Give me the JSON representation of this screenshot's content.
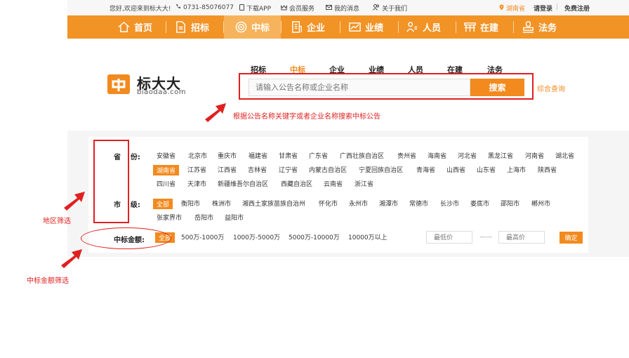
{
  "topbar": {
    "welcome": "您好,欢迎来到标大大!",
    "phone": "0731-85076077",
    "app": "下载APP",
    "member": "会员服务",
    "message": "我的消息",
    "about": "关于我们",
    "location": "湖南省",
    "login": "请登录",
    "divider": "|",
    "register": "免费注册"
  },
  "nav": {
    "items": [
      {
        "label": "首页",
        "icon": "home-icon"
      },
      {
        "label": "招标",
        "icon": "document-icon"
      },
      {
        "label": "中标",
        "icon": "target-icon"
      },
      {
        "label": "企业",
        "icon": "building-icon"
      },
      {
        "label": "业绩",
        "icon": "chart-icon"
      },
      {
        "label": "人员",
        "icon": "people-icon"
      },
      {
        "label": "在建",
        "icon": "construction-icon"
      },
      {
        "label": "法务",
        "icon": "legal-icon"
      }
    ],
    "active_index": 2,
    "accent": "#f29326"
  },
  "logo": {
    "name": "标大大",
    "domain": "biaodaa.com"
  },
  "search": {
    "tabs": [
      "招标",
      "中标",
      "企业",
      "业绩",
      "人员",
      "在建",
      "法务"
    ],
    "active_tab": "中标",
    "placeholder": "请输入公告名称或企业名称",
    "button": "搜索",
    "advanced": "综合查询"
  },
  "annotations": {
    "search": "根据公告名称关键字或者企业名称搜索中标公告",
    "region": "地区筛选",
    "amount": "中标金额筛选"
  },
  "filters": {
    "province_label": "省    份:",
    "provinces": [
      "安徽省",
      "北京市",
      "重庆市",
      "福建省",
      "甘肃省",
      "广东省",
      "广西壮族自治区",
      "贵州省",
      "海南省",
      "河北省",
      "黑龙江省",
      "河南省",
      "湖北省",
      "湖南省",
      "江苏省",
      "江西省",
      "吉林省",
      "辽宁省",
      "内蒙古自治区",
      "宁夏回族自治区",
      "青海省",
      "山西省",
      "山东省",
      "上海市",
      "陕西省",
      "四川省",
      "天津市",
      "新疆维吾尔自治区",
      "西藏自治区",
      "云南省",
      "浙江省"
    ],
    "province_selected": "湖南省",
    "city_label": "市    级:",
    "cities": [
      "全部",
      "衡阳市",
      "株洲市",
      "湘西土家族苗族自治州",
      "怀化市",
      "永州市",
      "湘潭市",
      "常德市",
      "长沙市",
      "娄底市",
      "邵阳市",
      "郴州市",
      "张家界市",
      "岳阳市",
      "益阳市"
    ],
    "city_selected": "全部",
    "amount_label": "中标金额:",
    "amounts": [
      "全部",
      "500万-1000万",
      "1000万-5000万",
      "5000万-10000万",
      "10000万以上"
    ],
    "amount_selected": "全部",
    "min_placeholder": "最低价",
    "dash": "——",
    "max_placeholder": "最高价",
    "confirm": "确定"
  }
}
